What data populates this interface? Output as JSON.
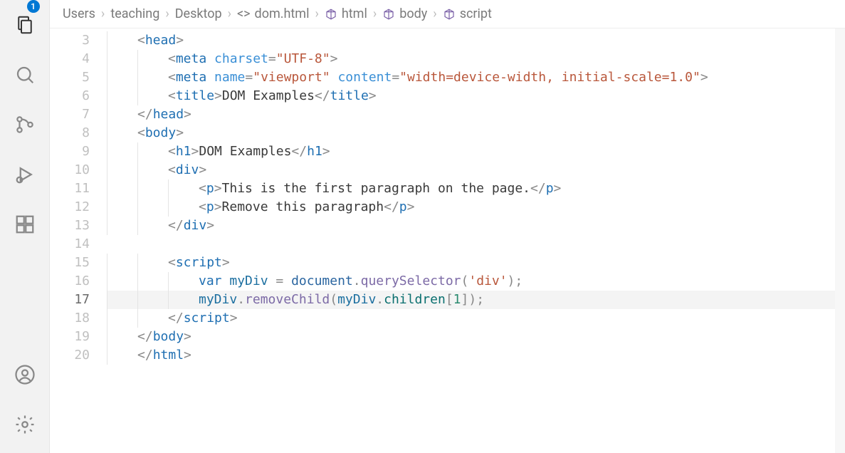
{
  "activity": {
    "badge": "1"
  },
  "breadcrumbs": {
    "items": [
      "Users",
      "teaching",
      "Desktop",
      "dom.html",
      "html",
      "body",
      "script"
    ]
  },
  "editor": {
    "line_start": 3,
    "current_line": 17,
    "lines": {
      "3": {
        "indent": 1,
        "tokens": [
          {
            "t": "punc",
            "v": "<"
          },
          {
            "t": "tag",
            "v": "head"
          },
          {
            "t": "punc",
            "v": ">"
          }
        ]
      },
      "4": {
        "indent": 2,
        "tokens": [
          {
            "t": "punc",
            "v": "<"
          },
          {
            "t": "tag",
            "v": "meta"
          },
          {
            "t": "txt",
            "v": " "
          },
          {
            "t": "attr",
            "v": "charset"
          },
          {
            "t": "punc",
            "v": "="
          },
          {
            "t": "str",
            "v": "\"UTF-8\""
          },
          {
            "t": "punc",
            "v": ">"
          }
        ]
      },
      "5": {
        "indent": 2,
        "tokens": [
          {
            "t": "punc",
            "v": "<"
          },
          {
            "t": "tag",
            "v": "meta"
          },
          {
            "t": "txt",
            "v": " "
          },
          {
            "t": "attr",
            "v": "name"
          },
          {
            "t": "punc",
            "v": "="
          },
          {
            "t": "str",
            "v": "\"viewport\""
          },
          {
            "t": "txt",
            "v": " "
          },
          {
            "t": "attr",
            "v": "content"
          },
          {
            "t": "punc",
            "v": "="
          },
          {
            "t": "str",
            "v": "\"width=device-width, initial-scale=1.0\""
          },
          {
            "t": "punc",
            "v": ">"
          }
        ]
      },
      "6": {
        "indent": 2,
        "tokens": [
          {
            "t": "punc",
            "v": "<"
          },
          {
            "t": "tag",
            "v": "title"
          },
          {
            "t": "punc",
            "v": ">"
          },
          {
            "t": "txt",
            "v": "DOM Examples"
          },
          {
            "t": "punc",
            "v": "</"
          },
          {
            "t": "tag",
            "v": "title"
          },
          {
            "t": "punc",
            "v": ">"
          }
        ]
      },
      "7": {
        "indent": 1,
        "tokens": [
          {
            "t": "punc",
            "v": "</"
          },
          {
            "t": "tag",
            "v": "head"
          },
          {
            "t": "punc",
            "v": ">"
          }
        ]
      },
      "8": {
        "indent": 1,
        "tokens": [
          {
            "t": "punc",
            "v": "<"
          },
          {
            "t": "tag",
            "v": "body"
          },
          {
            "t": "punc",
            "v": ">"
          }
        ]
      },
      "9": {
        "indent": 2,
        "tokens": [
          {
            "t": "punc",
            "v": "<"
          },
          {
            "t": "tag",
            "v": "h1"
          },
          {
            "t": "punc",
            "v": ">"
          },
          {
            "t": "txt",
            "v": "DOM Examples"
          },
          {
            "t": "punc",
            "v": "</"
          },
          {
            "t": "tag",
            "v": "h1"
          },
          {
            "t": "punc",
            "v": ">"
          }
        ]
      },
      "10": {
        "indent": 2,
        "tokens": [
          {
            "t": "punc",
            "v": "<"
          },
          {
            "t": "tag",
            "v": "div"
          },
          {
            "t": "punc",
            "v": ">"
          }
        ]
      },
      "11": {
        "indent": 3,
        "tokens": [
          {
            "t": "punc",
            "v": "<"
          },
          {
            "t": "tag",
            "v": "p"
          },
          {
            "t": "punc",
            "v": ">"
          },
          {
            "t": "txt",
            "v": "This is the first paragraph on the page."
          },
          {
            "t": "punc",
            "v": "</"
          },
          {
            "t": "tag",
            "v": "p"
          },
          {
            "t": "punc",
            "v": ">"
          }
        ]
      },
      "12": {
        "indent": 3,
        "tokens": [
          {
            "t": "punc",
            "v": "<"
          },
          {
            "t": "tag",
            "v": "p"
          },
          {
            "t": "punc",
            "v": ">"
          },
          {
            "t": "txt",
            "v": "Remove this paragraph"
          },
          {
            "t": "punc",
            "v": "</"
          },
          {
            "t": "tag",
            "v": "p"
          },
          {
            "t": "punc",
            "v": ">"
          }
        ]
      },
      "13": {
        "indent": 2,
        "tokens": [
          {
            "t": "punc",
            "v": "</"
          },
          {
            "t": "tag",
            "v": "div"
          },
          {
            "t": "punc",
            "v": ">"
          }
        ]
      },
      "14": {
        "indent": 0,
        "tokens": []
      },
      "15": {
        "indent": 2,
        "tokens": [
          {
            "t": "punc",
            "v": "<"
          },
          {
            "t": "tag",
            "v": "script"
          },
          {
            "t": "punc",
            "v": ">"
          }
        ]
      },
      "16": {
        "indent": 3,
        "tokens": [
          {
            "t": "kw",
            "v": "var"
          },
          {
            "t": "txt",
            "v": " "
          },
          {
            "t": "ident",
            "v": "myDiv"
          },
          {
            "t": "txt",
            "v": " "
          },
          {
            "t": "punc",
            "v": "="
          },
          {
            "t": "txt",
            "v": " "
          },
          {
            "t": "obj",
            "v": "document"
          },
          {
            "t": "punc",
            "v": "."
          },
          {
            "t": "func",
            "v": "querySelector"
          },
          {
            "t": "punc",
            "v": "("
          },
          {
            "t": "str",
            "v": "'div'"
          },
          {
            "t": "punc",
            "v": ");"
          }
        ]
      },
      "17": {
        "indent": 3,
        "tokens": [
          {
            "t": "ident",
            "v": "myDiv"
          },
          {
            "t": "punc",
            "v": "."
          },
          {
            "t": "func",
            "v": "removeChild"
          },
          {
            "t": "punc",
            "v": "("
          },
          {
            "t": "ident",
            "v": "myDiv"
          },
          {
            "t": "punc",
            "v": "."
          },
          {
            "t": "prop",
            "v": "children"
          },
          {
            "t": "punc",
            "v": "["
          },
          {
            "t": "num",
            "v": "1"
          },
          {
            "t": "punc",
            "v": "]);"
          }
        ]
      },
      "18": {
        "indent": 2,
        "tokens": [
          {
            "t": "punc",
            "v": "</"
          },
          {
            "t": "tag",
            "v": "script"
          },
          {
            "t": "punc",
            "v": ">"
          }
        ]
      },
      "19": {
        "indent": 1,
        "tokens": [
          {
            "t": "punc",
            "v": "</"
          },
          {
            "t": "tag",
            "v": "body"
          },
          {
            "t": "punc",
            "v": ">"
          }
        ]
      },
      "20": {
        "indent": 1,
        "tokens": [
          {
            "t": "punc",
            "v": "</"
          },
          {
            "t": "tag",
            "v": "html"
          },
          {
            "t": "punc",
            "v": ">"
          }
        ]
      }
    }
  }
}
